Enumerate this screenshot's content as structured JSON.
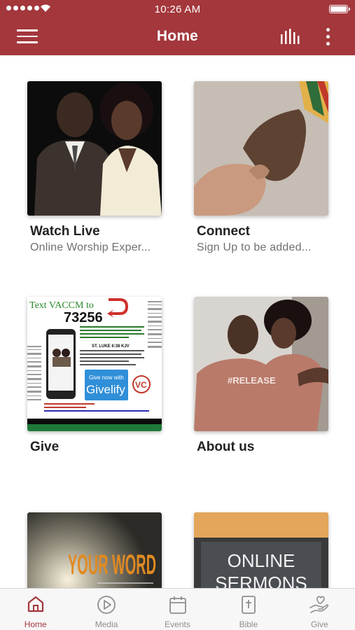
{
  "status_bar": {
    "time": "10:26 AM"
  },
  "header": {
    "title": "Home"
  },
  "tiles": [
    {
      "title": "Watch Live",
      "subtitle": "Online Worship Exper..."
    },
    {
      "title": "Connect",
      "subtitle": "Sign Up to be added..."
    },
    {
      "title": "Give",
      "subtitle": ""
    },
    {
      "title": "About us",
      "subtitle": ""
    },
    {
      "title": "",
      "subtitle": ""
    },
    {
      "title": "",
      "subtitle": ""
    }
  ],
  "give_flyer": {
    "text_line": "Text VACCM to",
    "number": "73256",
    "scripture_ref": "ST. LUKE 6:38 KJV",
    "button_label": "Give now with",
    "brand": "Givelify",
    "logo": "VC"
  },
  "your_word_image": {
    "text": "YOUR WORD"
  },
  "online_sermons_image": {
    "line1": "ONLINE",
    "line2": "SERMONS"
  },
  "about_image": {
    "shirt_text": "#RELEASE"
  },
  "tab_bar": {
    "tabs": [
      {
        "label": "Home",
        "icon": "home-icon",
        "active": true
      },
      {
        "label": "Media",
        "icon": "play-circle-icon",
        "active": false
      },
      {
        "label": "Events",
        "icon": "calendar-icon",
        "active": false
      },
      {
        "label": "Bible",
        "icon": "bible-icon",
        "active": false
      },
      {
        "label": "Give",
        "icon": "give-hand-icon",
        "active": false
      }
    ]
  },
  "colors": {
    "brand": "#a3373c",
    "tab_inactive": "#8e8e8e"
  }
}
